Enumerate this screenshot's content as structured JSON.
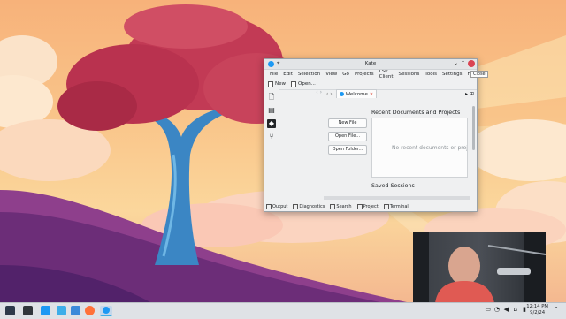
{
  "window": {
    "title": "Kate",
    "tooltip_close": "Close",
    "menu": [
      "File",
      "Edit",
      "Selection",
      "View",
      "Go",
      "Projects",
      "LSP Client",
      "Sessions",
      "Tools",
      "Settings",
      "Help"
    ],
    "toolbar": {
      "new_label": "New",
      "open_label": "Open..."
    },
    "tab": {
      "label": "Welcome"
    },
    "buttons": {
      "new_file": "New File",
      "open_file": "Open File...",
      "open_folder": "Open Folder..."
    },
    "recent_title": "Recent Documents and Projects",
    "recent_empty": "No recent documents or projects",
    "saved_sessions_title": "Saved Sessions",
    "statusbar": [
      "Output",
      "Diagnostics",
      "Search",
      "Project",
      "Terminal"
    ]
  },
  "taskbar": {
    "clock_time": "12:14 PM",
    "clock_date": "9/2/24"
  },
  "colors": {
    "accent": "#3daee9",
    "close_button": "#da4453",
    "kate_icon": "#1d99f3"
  },
  "icons": [
    "kde-launcher-icon",
    "terminal-icon",
    "dolphin-files-icon",
    "file-manager-icon",
    "firefox-icon",
    "kate-icon",
    "document-icon",
    "filesystem-icon",
    "git-icon",
    "projects-icon",
    "network-icon",
    "volume-icon",
    "battery-icon",
    "clipboard-icon",
    "notifications-icon",
    "chevron-up-icon"
  ]
}
